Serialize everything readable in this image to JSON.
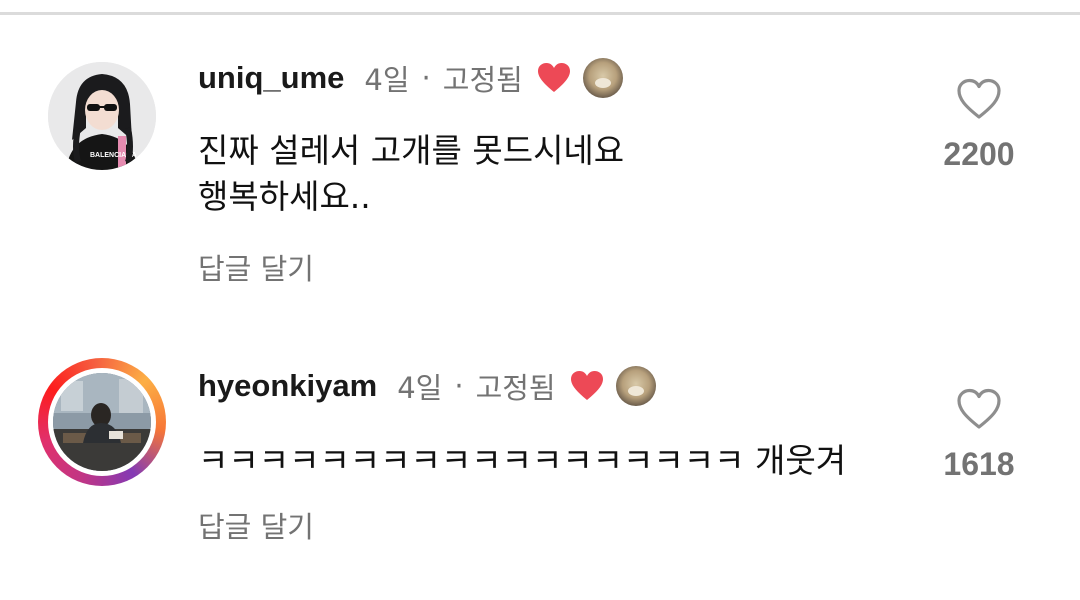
{
  "comments": [
    {
      "username": "uniq_ume",
      "time": "4일",
      "separator": "·",
      "pinned_label": "고정됨",
      "text_lines": [
        "진짜 설레서 고개를 못드시네요",
        "행복하세요.."
      ],
      "reply_label": "답글 달기",
      "like_count": "2200",
      "avatar_icon": "profile-photo",
      "has_story_ring": false
    },
    {
      "username": "hyeonkiyam",
      "time": "4일",
      "separator": "·",
      "pinned_label": "고정됨",
      "text_lines": [
        "ㅋㅋㅋㅋㅋㅋㅋㅋㅋㅋㅋㅋㅋㅋㅋㅋㅋㅋ 개웃겨"
      ],
      "reply_label": "답글 달기",
      "like_count": "1618",
      "avatar_icon": "profile-photo",
      "has_story_ring": true
    }
  ],
  "colors": {
    "like_red": "#ed4956",
    "secondary_text": "#737373",
    "story_ring": "#e1306c"
  },
  "icons": {
    "creator_liked": "heart-filled-icon",
    "like_button": "heart-outline-icon",
    "creator_avatar": "creator-avatar"
  }
}
